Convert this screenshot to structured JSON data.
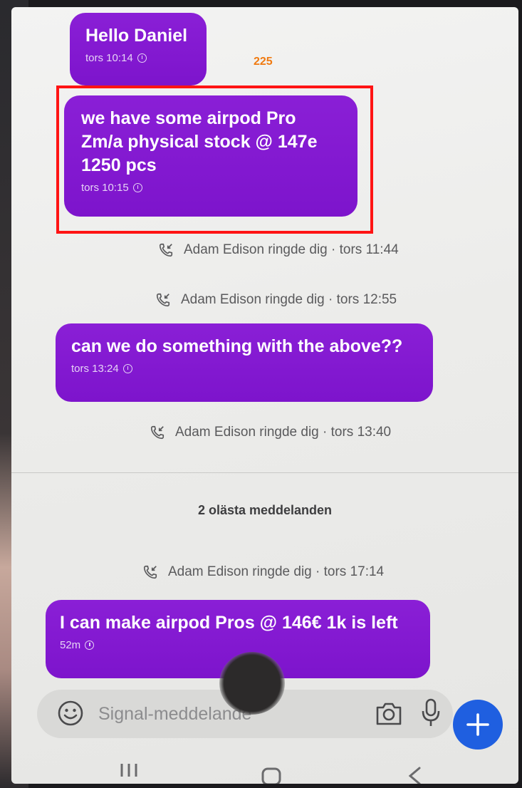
{
  "annotation": {
    "label": "225"
  },
  "messages": [
    {
      "text": "Hello Daniel",
      "time": "tors 10:14"
    },
    {
      "text": "we have some airpod Pro\nZm/a physical stock @ 147e\n1250 pcs",
      "time": "tors 10:15"
    },
    {
      "text": "can we do something with the above??",
      "time": "tors 13:24"
    },
    {
      "text": "I can make airpod Pros @ 146€ 1k is left",
      "time": "52m"
    }
  ],
  "calls": [
    {
      "text": "Adam Edison ringde dig · tors 11:44"
    },
    {
      "text": "Adam Edison ringde dig · tors 12:55"
    },
    {
      "text": "Adam Edison ringde dig · tors 13:40"
    },
    {
      "text": "Adam Edison ringde dig · tors 17:14"
    }
  ],
  "unread_divider": {
    "label": "2 olästa meddelanden"
  },
  "composer": {
    "placeholder": "Signal-meddelande"
  },
  "colors": {
    "bubble": "#8a1fd6",
    "send_button": "#1f5fe0",
    "highlight": "#ff1414",
    "annotation": "#f07a10"
  }
}
